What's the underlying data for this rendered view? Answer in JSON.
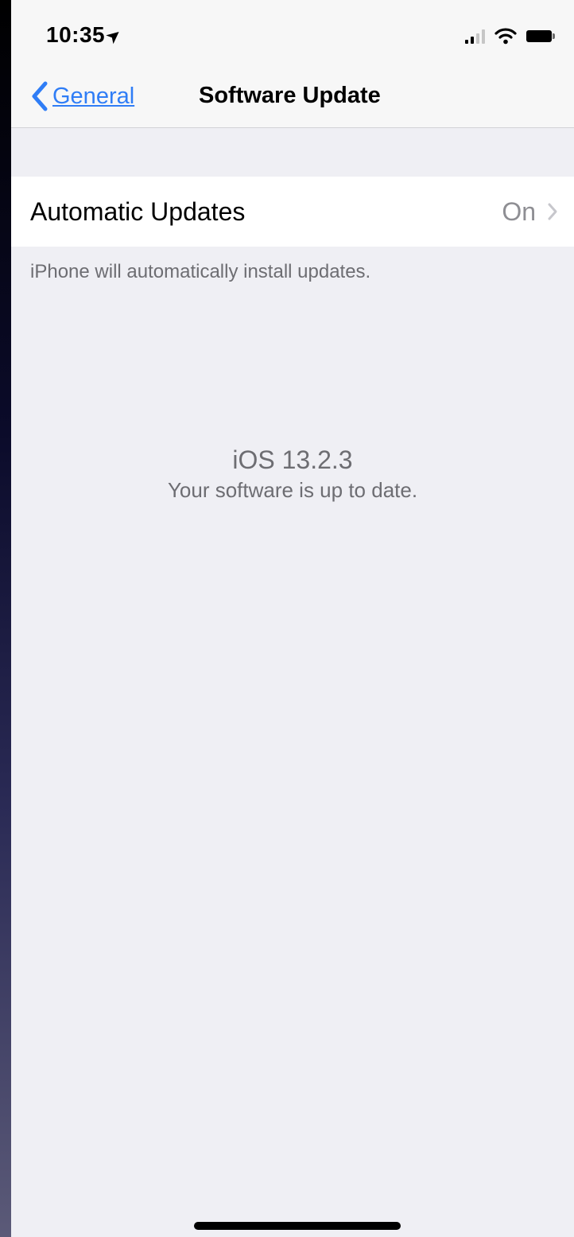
{
  "status_bar": {
    "time": "10:35",
    "location_icon": "location-arrow-icon",
    "signal_icon": "cellular-signal-icon",
    "wifi_icon": "wifi-icon",
    "battery_icon": "battery-icon"
  },
  "nav": {
    "back_label": "General",
    "title": "Software Update",
    "accent_color": "#2f7df6"
  },
  "automatic_updates": {
    "label": "Automatic Updates",
    "value": "On",
    "footer": "iPhone will automatically install updates."
  },
  "version": {
    "name": "iOS 13.2.3",
    "status": "Your software is up to date."
  }
}
